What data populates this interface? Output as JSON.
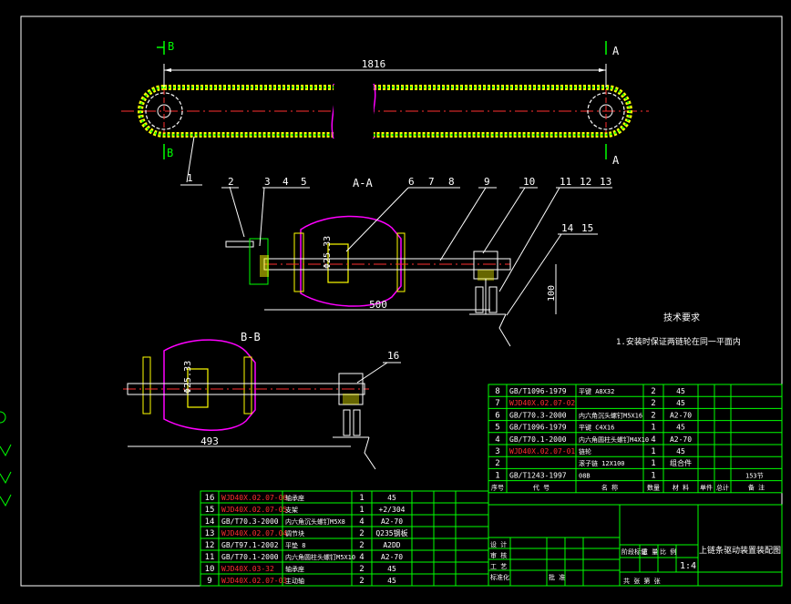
{
  "drawing": {
    "top_dimension": "1816",
    "section_marks": {
      "b_left_top": "B",
      "b_left_bottom": "B",
      "a_right_top": "A",
      "a_right_bottom": "A"
    },
    "view_aa_title": "A-A",
    "view_bb_title": "B-B",
    "dim_500": "500",
    "dim_100": "100",
    "dim_493": "493",
    "dim_phi_aa": "Φ25.33",
    "dim_phi_bb": "Φ25.33",
    "balloons": [
      "1",
      "2",
      "3",
      "4",
      "5",
      "6",
      "7",
      "8",
      "9",
      "10",
      "11",
      "12",
      "13",
      "14",
      "15",
      "16"
    ],
    "tech_req_title": "技术要求",
    "tech_req_item": "1.安装时保证两链轮在同一平面内"
  },
  "upper_parts": [
    {
      "no": "8",
      "code": "GB/T1096-1979",
      "name": "平键 A8X32",
      "qty": "2",
      "mat": "45"
    },
    {
      "no": "7",
      "code": "WJD40X.02.07-02",
      "name": "",
      "qty": "2",
      "mat": "45"
    },
    {
      "no": "6",
      "code": "GB/T70.3-2000",
      "name": "内六角沉头螺钉M5X16",
      "qty": "2",
      "mat": "A2-70"
    },
    {
      "no": "5",
      "code": "GB/T1096-1979",
      "name": "平键 C4X16",
      "qty": "1",
      "mat": "45"
    },
    {
      "no": "4",
      "code": "GB/T70.1-2000",
      "name": "内六角圆柱头螺钉M4X10",
      "qty": "4",
      "mat": "A2-70"
    },
    {
      "no": "3",
      "code": "WJD40X.02.07-01",
      "name": "链轮",
      "qty": "1",
      "mat": "45"
    },
    {
      "no": "2",
      "code": "",
      "name": "滚子链 12X100",
      "qty": "1",
      "mat": "组合件"
    },
    {
      "no": "1",
      "code": "GB/T1243-1997",
      "name": "08B",
      "qty": "1",
      "mat": "",
      "note": "153节"
    }
  ],
  "upper_header": [
    "序号",
    "代 号",
    "名 称",
    "数量",
    "材 料",
    "单件",
    "总计",
    "备 注"
  ],
  "lower_parts": [
    {
      "no": "16",
      "code": "WJD40X.02.07-06",
      "name": "轴承座",
      "qty": "1",
      "mat": "45"
    },
    {
      "no": "15",
      "code": "WJD40X.02.07-05",
      "name": "支架",
      "qty": "1",
      "mat": "+2/304"
    },
    {
      "no": "14",
      "code": "GB/T70.3-2000",
      "name": "内六角沉头螺钉M5X8",
      "qty": "4",
      "mat": "A2-70"
    },
    {
      "no": "13",
      "code": "WJD40X.02.07.04",
      "name": "调节块",
      "qty": "2",
      "mat": "Q235钢板"
    },
    {
      "no": "12",
      "code": "GB/T97.1-2002",
      "name": "平垫 8",
      "qty": "2",
      "mat": "A2DD"
    },
    {
      "no": "11",
      "code": "GB/T70.1-2000",
      "name": "内六角圆柱头螺钉M5X10",
      "qty": "4",
      "mat": "A2-70"
    },
    {
      "no": "10",
      "code": "WJD40X.03-32",
      "name": "轴承座",
      "qty": "2",
      "mat": "45"
    },
    {
      "no": "9",
      "code": "WJD40X.02.07-03",
      "name": "主动轴",
      "qty": "2",
      "mat": "45"
    }
  ],
  "title_block": {
    "drawing_name": "上链条驱动装置装配图",
    "scale": "1:4",
    "row_labels": [
      "设 计",
      "审 核",
      "工 艺",
      "标准化",
      "批 准"
    ],
    "col_labels": [
      "阶段标记",
      "重 量",
      "比 例"
    ],
    "sheet_label": "共 张 第 张"
  },
  "colors": {
    "background": "#000000",
    "line": "#ffffff",
    "table": "#00ff00",
    "red_text": "#ff0000",
    "magenta": "#ff00ff",
    "yellow": "#ffff00",
    "cyan": "#00ffff"
  }
}
